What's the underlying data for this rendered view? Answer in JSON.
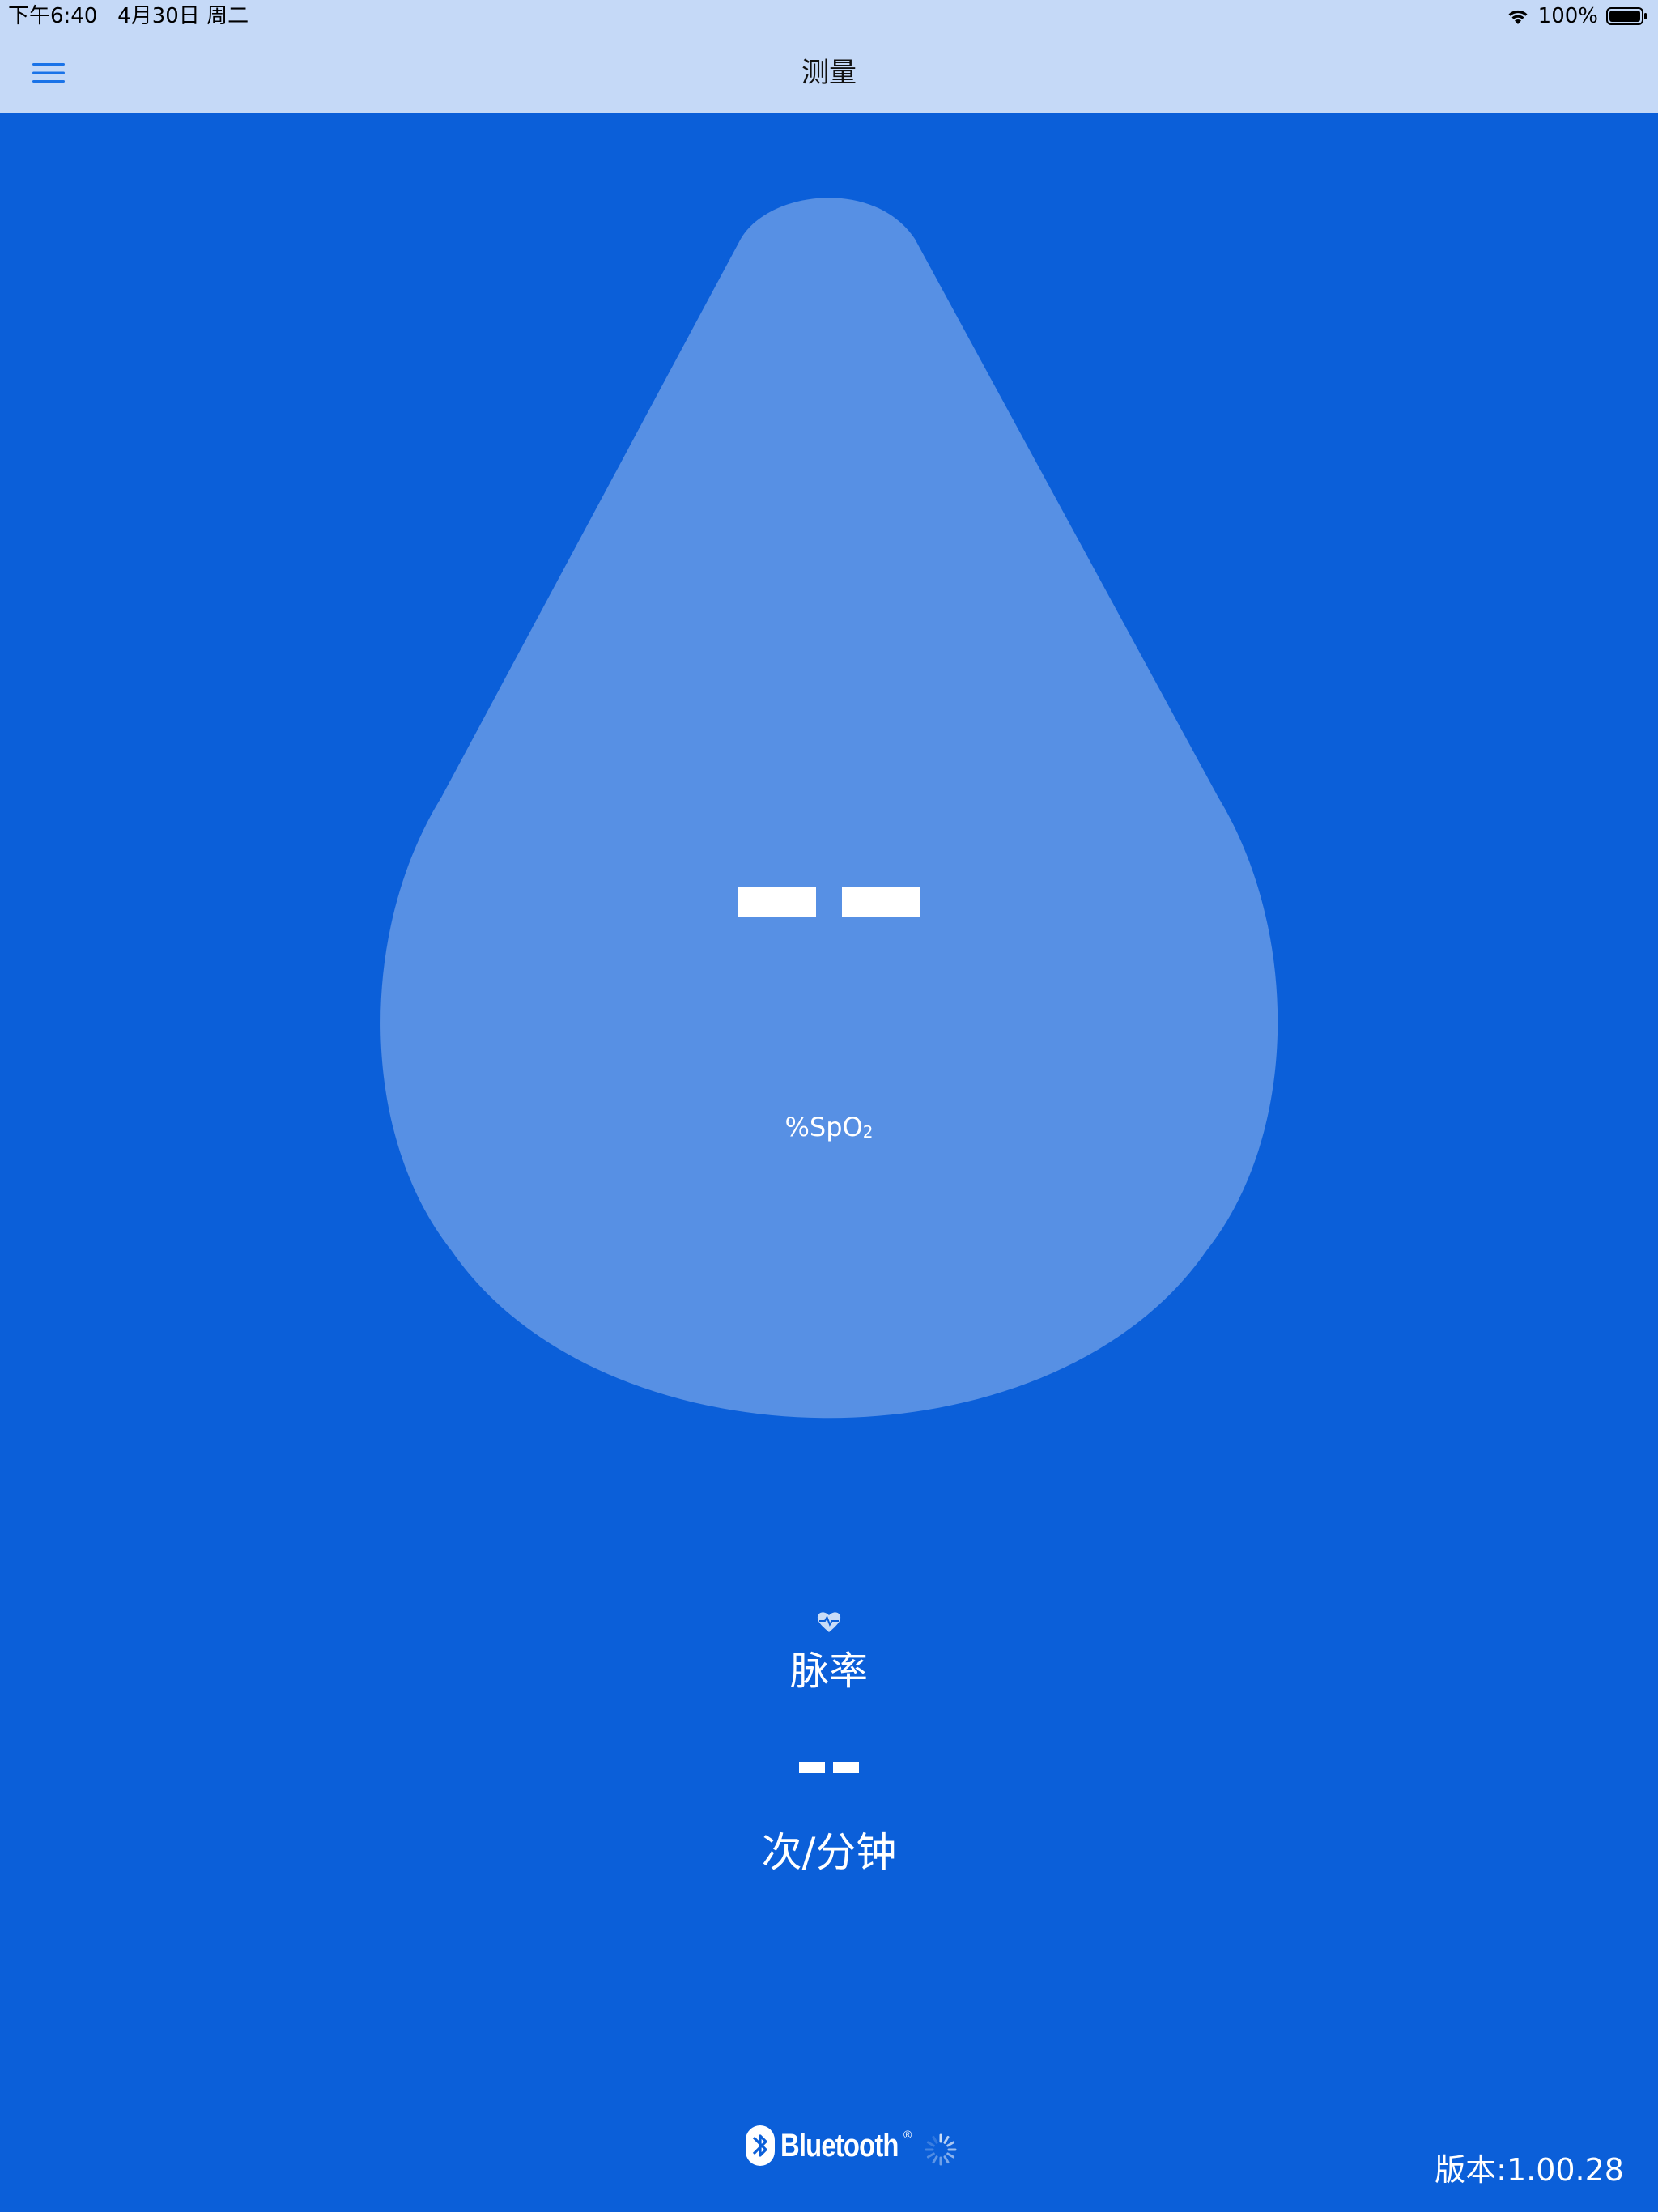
{
  "status_bar": {
    "time_date": "下午6:40   4月30日 周二",
    "battery": "100%"
  },
  "nav": {
    "title": "测量",
    "menu_icon": "hamburger-menu-icon"
  },
  "spo2": {
    "value_placeholder": "-- --",
    "unit_prefix": "%SpO",
    "unit_sub": "2"
  },
  "pulse": {
    "icon": "heart-pulse-icon",
    "label": "脉率",
    "value_placeholder": "--",
    "unit": "次/分钟"
  },
  "footer": {
    "bluetooth_label": "Bluetooth",
    "bluetooth_reg": "®",
    "version": "版本:1.00.28"
  },
  "colors": {
    "background": "#0b5fd9",
    "drop": "#5790e4",
    "top_bar": "#c5d9f7",
    "accent": "#1a73e8"
  }
}
